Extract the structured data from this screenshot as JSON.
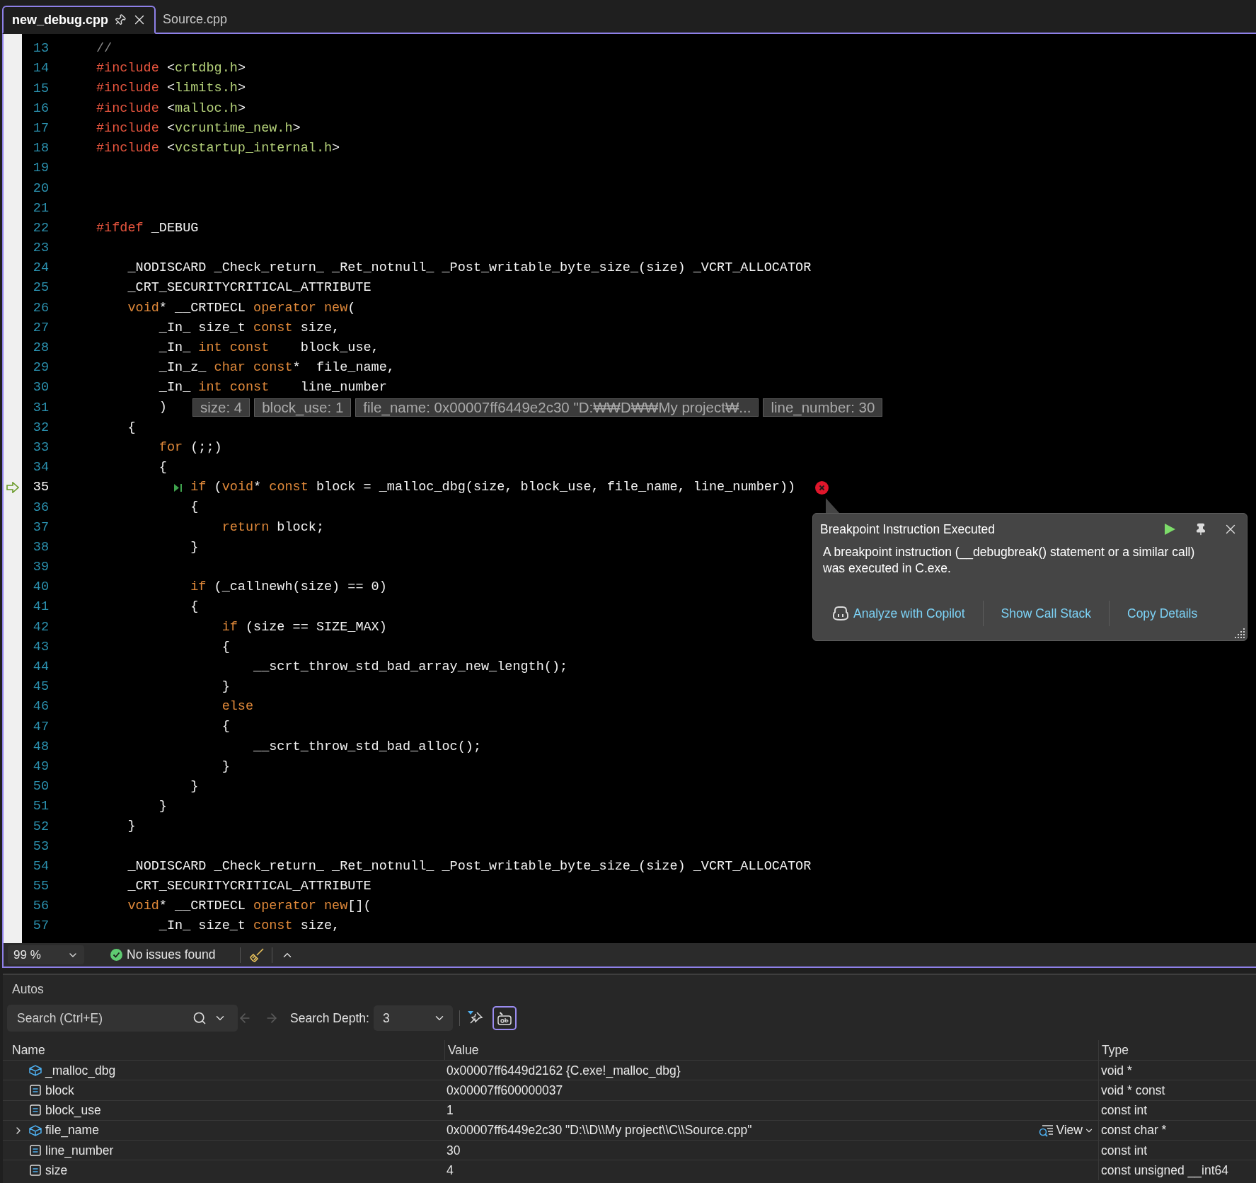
{
  "tabs": [
    {
      "label": "new_debug.cpp",
      "selected": true,
      "pinned": true
    },
    {
      "label": "Source.cpp",
      "selected": false,
      "pinned": false
    }
  ],
  "editor": {
    "lines": [
      {
        "number": "13",
        "current": false,
        "tokens": [
          {
            "kind": "comment",
            "t": "//"
          }
        ]
      },
      {
        "number": "14",
        "current": false,
        "tokens": [
          {
            "kind": "pp",
            "t": "#include"
          },
          {
            "kind": "plain",
            "t": " <"
          },
          {
            "kind": "str",
            "t": "crtdbg.h"
          },
          {
            "kind": "plain",
            "t": ">"
          }
        ]
      },
      {
        "number": "15",
        "current": false,
        "tokens": [
          {
            "kind": "pp",
            "t": "#include"
          },
          {
            "kind": "plain",
            "t": " <"
          },
          {
            "kind": "str",
            "t": "limits.h"
          },
          {
            "kind": "plain",
            "t": ">"
          }
        ]
      },
      {
        "number": "16",
        "current": false,
        "tokens": [
          {
            "kind": "pp",
            "t": "#include"
          },
          {
            "kind": "plain",
            "t": " <"
          },
          {
            "kind": "str",
            "t": "malloc.h"
          },
          {
            "kind": "plain",
            "t": ">"
          }
        ]
      },
      {
        "number": "17",
        "current": false,
        "tokens": [
          {
            "kind": "pp",
            "t": "#include"
          },
          {
            "kind": "plain",
            "t": " <"
          },
          {
            "kind": "str",
            "t": "vcruntime_new.h"
          },
          {
            "kind": "plain",
            "t": ">"
          }
        ]
      },
      {
        "number": "18",
        "current": false,
        "tokens": [
          {
            "kind": "pp",
            "t": "#include"
          },
          {
            "kind": "plain",
            "t": " <"
          },
          {
            "kind": "str",
            "t": "vcstartup_internal.h"
          },
          {
            "kind": "plain",
            "t": ">"
          }
        ]
      },
      {
        "number": "19",
        "current": false
      },
      {
        "number": "20",
        "current": false
      },
      {
        "number": "21",
        "current": false
      },
      {
        "number": "22",
        "current": false,
        "tokens": [
          {
            "kind": "pp",
            "t": "#ifdef"
          },
          {
            "kind": "plain",
            "t": " _DEBUG"
          }
        ]
      },
      {
        "number": "23",
        "current": false
      },
      {
        "number": "24",
        "current": false,
        "tokens": [
          {
            "kind": "plain",
            "t": "    _NODISCARD _Check_return_ _Ret_notnull_ _Post_writable_byte_size_(size) _VCRT_ALLOCATOR"
          }
        ]
      },
      {
        "number": "25",
        "current": false,
        "tokens": [
          {
            "kind": "plain",
            "t": "    _CRT_SECURITYCRITICAL_ATTRIBUTE"
          }
        ]
      },
      {
        "number": "26",
        "current": false,
        "tokens": [
          {
            "kind": "kw",
            "t": "    void"
          },
          {
            "kind": "plain",
            "t": "* __CRTDECL "
          },
          {
            "kind": "kw",
            "t": "operator new"
          },
          {
            "kind": "plain",
            "t": "("
          }
        ]
      },
      {
        "number": "27",
        "current": false,
        "tokens": [
          {
            "kind": "plain",
            "t": "        _In_ size_t "
          },
          {
            "kind": "kw",
            "t": "const"
          },
          {
            "kind": "plain",
            "t": " size,"
          }
        ]
      },
      {
        "number": "28",
        "current": false,
        "tokens": [
          {
            "kind": "plain",
            "t": "        _In_ "
          },
          {
            "kind": "kw",
            "t": "int const"
          },
          {
            "kind": "plain",
            "t": "    block_use,"
          }
        ]
      },
      {
        "number": "29",
        "current": false,
        "tokens": [
          {
            "kind": "plain",
            "t": "        _In_z_ "
          },
          {
            "kind": "kw",
            "t": "char const"
          },
          {
            "kind": "plain",
            "t": "*  file_name,"
          }
        ]
      },
      {
        "number": "30",
        "current": false,
        "tokens": [
          {
            "kind": "plain",
            "t": "        _In_ "
          },
          {
            "kind": "kw",
            "t": "int const"
          },
          {
            "kind": "plain",
            "t": "    line_number"
          }
        ]
      },
      {
        "number": "31",
        "current": false,
        "tokens": [
          {
            "kind": "plain",
            "t": "        )"
          }
        ],
        "datatips": [
          "size: 4",
          "block_use: 1",
          "file_name: 0x00007ff6449e2c30 \"D:₩₩D₩₩My project₩...",
          "line_number: 30"
        ]
      },
      {
        "number": "32",
        "current": false,
        "tokens": [
          {
            "kind": "plain",
            "t": "    {"
          }
        ]
      },
      {
        "number": "33",
        "current": false,
        "tokens": [
          {
            "kind": "kw",
            "t": "        for"
          },
          {
            "kind": "plain",
            "t": " (;;)"
          }
        ]
      },
      {
        "number": "34",
        "current": false,
        "tokens": [
          {
            "kind": "plain",
            "t": "        {"
          }
        ]
      },
      {
        "number": "35",
        "current": true,
        "tokens": [
          {
            "kind": "kw",
            "t": "            if"
          },
          {
            "kind": "plain",
            "t": " ("
          },
          {
            "kind": "kw",
            "t": "void"
          },
          {
            "kind": "plain",
            "t": "* "
          },
          {
            "kind": "kw",
            "t": "const"
          },
          {
            "kind": "plain",
            "t": " block = _malloc_dbg(size, block_use, file_name, line_number))"
          }
        ]
      },
      {
        "number": "36",
        "current": false,
        "tokens": [
          {
            "kind": "plain",
            "t": "            {"
          }
        ]
      },
      {
        "number": "37",
        "current": false,
        "tokens": [
          {
            "kind": "kw",
            "t": "                return"
          },
          {
            "kind": "plain",
            "t": " block;"
          }
        ]
      },
      {
        "number": "38",
        "current": false,
        "tokens": [
          {
            "kind": "plain",
            "t": "            }"
          }
        ]
      },
      {
        "number": "39",
        "current": false
      },
      {
        "number": "40",
        "current": false,
        "tokens": [
          {
            "kind": "kw",
            "t": "            if"
          },
          {
            "kind": "plain",
            "t": " (_callnewh(size) == 0)"
          }
        ]
      },
      {
        "number": "41",
        "current": false,
        "tokens": [
          {
            "kind": "plain",
            "t": "            {"
          }
        ]
      },
      {
        "number": "42",
        "current": false,
        "tokens": [
          {
            "kind": "kw",
            "t": "                if"
          },
          {
            "kind": "plain",
            "t": " (size == SIZE_MAX)"
          }
        ]
      },
      {
        "number": "43",
        "current": false,
        "tokens": [
          {
            "kind": "plain",
            "t": "                {"
          }
        ]
      },
      {
        "number": "44",
        "current": false,
        "tokens": [
          {
            "kind": "plain",
            "t": "                    __scrt_throw_std_bad_array_new_length();"
          }
        ]
      },
      {
        "number": "45",
        "current": false,
        "tokens": [
          {
            "kind": "plain",
            "t": "                }"
          }
        ]
      },
      {
        "number": "46",
        "current": false,
        "tokens": [
          {
            "kind": "kw",
            "t": "                else"
          }
        ]
      },
      {
        "number": "47",
        "current": false,
        "tokens": [
          {
            "kind": "plain",
            "t": "                {"
          }
        ]
      },
      {
        "number": "48",
        "current": false,
        "tokens": [
          {
            "kind": "plain",
            "t": "                    __scrt_throw_std_bad_alloc();"
          }
        ]
      },
      {
        "number": "49",
        "current": false,
        "tokens": [
          {
            "kind": "plain",
            "t": "                }"
          }
        ]
      },
      {
        "number": "50",
        "current": false,
        "tokens": [
          {
            "kind": "plain",
            "t": "            }"
          }
        ]
      },
      {
        "number": "51",
        "current": false,
        "tokens": [
          {
            "kind": "plain",
            "t": "        }"
          }
        ]
      },
      {
        "number": "52",
        "current": false,
        "tokens": [
          {
            "kind": "plain",
            "t": "    }"
          }
        ]
      },
      {
        "number": "53",
        "current": false
      },
      {
        "number": "54",
        "current": false,
        "tokens": [
          {
            "kind": "plain",
            "t": "    _NODISCARD _Check_return_ _Ret_notnull_ _Post_writable_byte_size_(size) _VCRT_ALLOCATOR"
          }
        ]
      },
      {
        "number": "55",
        "current": false,
        "tokens": [
          {
            "kind": "plain",
            "t": "    _CRT_SECURITYCRITICAL_ATTRIBUTE"
          }
        ]
      },
      {
        "number": "56",
        "current": false,
        "tokens": [
          {
            "kind": "kw",
            "t": "    void"
          },
          {
            "kind": "plain",
            "t": "* __CRTDECL "
          },
          {
            "kind": "kw",
            "t": "operator new"
          },
          {
            "kind": "plain",
            "t": "[]("
          }
        ]
      },
      {
        "number": "57",
        "current": false,
        "tokens": [
          {
            "kind": "plain",
            "t": "        _In_ size_t "
          },
          {
            "kind": "kw",
            "t": "const"
          },
          {
            "kind": "plain",
            "t": " size,"
          }
        ]
      }
    ]
  },
  "exception_popup": {
    "title": "Breakpoint Instruction Executed",
    "message": "A breakpoint instruction (__debugbreak() statement or a similar call) was executed in C.exe.",
    "actions": [
      {
        "label": "Analyze with Copilot",
        "kind": "copilot"
      },
      {
        "label": "Show Call Stack",
        "kind": "link"
      },
      {
        "label": "Copy Details",
        "kind": "link"
      }
    ]
  },
  "status_bar": {
    "zoom": "99 %",
    "issues": "No issues found"
  },
  "autos": {
    "title": "Autos",
    "search": {
      "placeholder": "Search (Ctrl+E)"
    },
    "depth_label": "Search Depth:",
    "depth": "3",
    "format_toggle": {
      "selected": true
    },
    "columns": [
      "Name",
      "Value",
      "Type"
    ],
    "rows": [
      {
        "name": "_malloc_dbg",
        "value": "0x00007ff6449d2162 {C.exe!_malloc_dbg}",
        "type": "void *",
        "kind": "function",
        "expandable": false
      },
      {
        "name": "block",
        "value": "0x00007ff600000037",
        "type": "void * const",
        "kind": "variable",
        "expandable": false
      },
      {
        "name": "block_use",
        "value": "1",
        "type": "const int",
        "kind": "variable",
        "expandable": false
      },
      {
        "name": "file_name",
        "value": "0x00007ff6449e2c30 \"D:\\\\D\\\\My project\\\\C\\\\Source.cpp\"",
        "type": "const char *",
        "kind": "function",
        "expandable": true,
        "visualizer": "View"
      },
      {
        "name": "line_number",
        "value": "30",
        "type": "const int",
        "kind": "variable",
        "expandable": false
      },
      {
        "name": "size",
        "value": "4",
        "type": "const unsigned __int64",
        "kind": "variable",
        "expandable": false
      }
    ]
  }
}
